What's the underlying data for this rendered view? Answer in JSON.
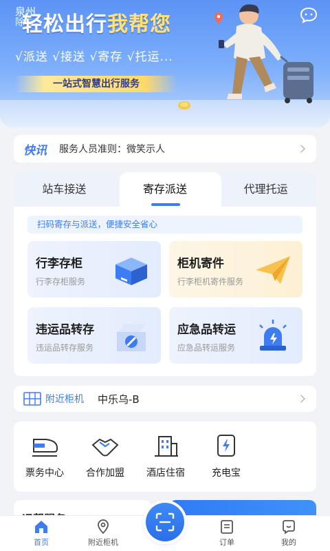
{
  "banner": {
    "city": "泉州",
    "city_sub": "除G",
    "title_main": "轻松出行",
    "title_highlight": "我帮您",
    "services": "√派送 √接送 √寄存 √托运...",
    "slogan": "一站式智慧出行服务"
  },
  "notice": {
    "brand": "快讯",
    "text": "服务人员准则：微笑示人"
  },
  "tabs": [
    "站车接送",
    "寄存派送",
    "代理托运"
  ],
  "tip": "扫码寄存与派送，便捷安全省心",
  "service_cards": [
    {
      "title": "行李存柜",
      "subtitle": "行李存柜服务",
      "icon": "cabinet-box-icon"
    },
    {
      "title": "柜机寄件",
      "subtitle": "行李柜机寄件服务",
      "icon": "paper-plane-icon"
    },
    {
      "title": "违运品转存",
      "subtitle": "违运品转存服务",
      "icon": "prohibited-box-icon"
    },
    {
      "title": "应急品转运",
      "subtitle": "应急品转运服务",
      "icon": "alarm-light-icon"
    }
  ],
  "nearby": {
    "label": "附近柜机",
    "name": "中乐乌-B"
  },
  "quick_actions": [
    {
      "label": "票务中心",
      "icon": "train-icon"
    },
    {
      "label": "合作加盟",
      "icon": "handshake-icon"
    },
    {
      "label": "酒店住宿",
      "icon": "hotel-icon"
    },
    {
      "label": "充电宝",
      "icon": "power-bank-icon"
    }
  ],
  "peek_title": "运帮服务",
  "bottom_nav": [
    {
      "label": "首页",
      "icon": "home-icon"
    },
    {
      "label": "附近柜机",
      "icon": "location-icon"
    },
    {
      "label": "订单",
      "icon": "order-icon"
    },
    {
      "label": "我的",
      "icon": "profile-icon"
    }
  ],
  "colors": {
    "accent": "#3d7cf2",
    "banner_top": "#5c93f5",
    "highlight": "#ffe27a",
    "background": "#f1f3f7"
  }
}
